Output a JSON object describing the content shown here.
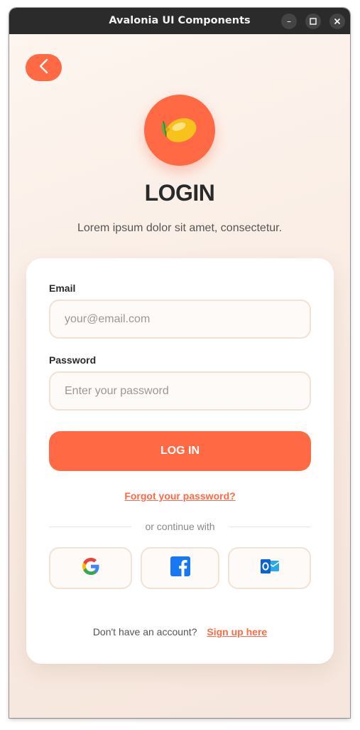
{
  "window": {
    "title": "Avalonia UI Components",
    "controls": {
      "minimize": "–",
      "maximize": "☐",
      "close": "✕"
    }
  },
  "header": {
    "back_icon": "chevron-left-icon",
    "logo_icon": "lemon-icon",
    "title": "LOGIN",
    "subtitle": "Lorem ipsum dolor sit amet, consectetur."
  },
  "form": {
    "email_label": "Email",
    "email_placeholder": "your@email.com",
    "email_value": "",
    "password_label": "Password",
    "password_placeholder": "Enter your password",
    "password_value": "",
    "submit_label": "LOG IN",
    "forgot_label": "Forgot your password?",
    "divider_text": "or continue with"
  },
  "social": [
    {
      "name": "google",
      "icon": "google-icon"
    },
    {
      "name": "facebook",
      "icon": "facebook-icon"
    },
    {
      "name": "outlook",
      "icon": "outlook-icon"
    }
  ],
  "footer": {
    "question": "Don't have an account?",
    "signup_label": "Sign up here"
  },
  "colors": {
    "accent": "#ff6a45",
    "titlebar": "#2b2b2b",
    "background": "#f9ede5",
    "card": "#ffffff"
  }
}
